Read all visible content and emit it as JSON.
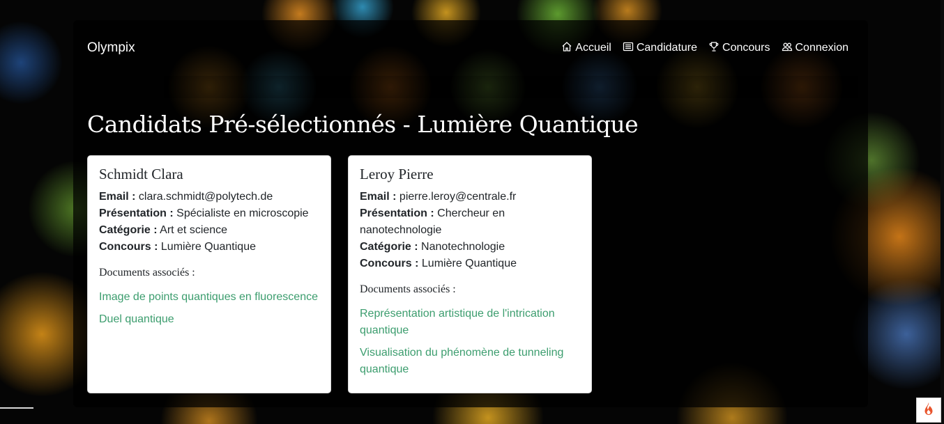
{
  "navbar": {
    "brand": "Olympix",
    "links": [
      {
        "label": "Accueil",
        "icon": "house-icon"
      },
      {
        "label": "Candidature",
        "icon": "newspaper-icon"
      },
      {
        "label": "Concours",
        "icon": "trophy-icon"
      },
      {
        "label": "Connexion",
        "icon": "people-icon"
      }
    ]
  },
  "page": {
    "title": "Candidats Pré-sélectionnés - Lumière Quantique"
  },
  "labels": {
    "email": "Email :",
    "presentation": "Présentation :",
    "categorie": "Catégorie :",
    "concours": "Concours :",
    "documents": "Documents associés :"
  },
  "candidates": [
    {
      "name": "Schmidt Clara",
      "email": "clara.schmidt@polytech.de",
      "presentation": "Spécialiste en microscopie",
      "categorie": "Art et science",
      "concours": "Lumière Quantique",
      "documents": [
        "Image de points quantiques en fluorescence",
        "Duel quantique"
      ]
    },
    {
      "name": "Leroy Pierre",
      "email": "pierre.leroy@centrale.fr",
      "presentation": "Chercheur en nanotechnologie",
      "categorie": "Nanotechnologie",
      "concours": "Lumière Quantique",
      "documents": [
        "Représentation artistique de l'intrication quantique",
        "Visualisation du phénomène de tunneling quantique"
      ]
    }
  ],
  "colors": {
    "link": "#3c9d6e",
    "fab_icon": "#e8542c"
  },
  "fab": {
    "icon": "flame-icon"
  }
}
